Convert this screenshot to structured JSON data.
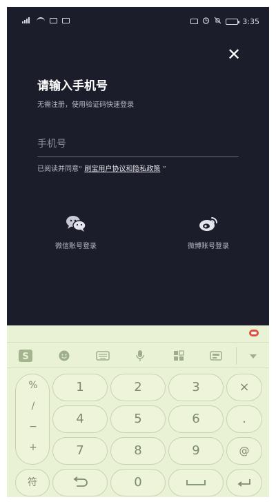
{
  "status_bar": {
    "left_icons": [
      "signal-icon",
      "wifi-icon",
      "sim-icon",
      "sim-icon"
    ],
    "right_icons": [
      "nfc-icon",
      "alarm-icon",
      "mute-icon",
      "battery-icon"
    ],
    "time": "3:35"
  },
  "login": {
    "close_symbol": "✕",
    "title": "请输入手机号",
    "subtitle": "无需注册，使用验证码快速登录",
    "phone_placeholder": "手机号",
    "agreement_prefix": "已阅读并同意",
    "agreement_open": "“",
    "agreement_link": "刷宝用户协议和隐私政策",
    "agreement_close": "”"
  },
  "social": {
    "wechat_label": "微信账号登录",
    "weibo_label": "微博账号登录"
  },
  "keyboard": {
    "toolbar_icons": [
      "sogou-logo-icon",
      "emoji-icon",
      "keyboard-icon",
      "microphone-icon",
      "apps-grid-icon",
      "clipboard-icon",
      "collapse-icon"
    ],
    "side_symbols": [
      "%",
      "/",
      "−",
      "+"
    ],
    "rows": [
      [
        "1",
        "2",
        "3"
      ],
      [
        "4",
        "5",
        "6"
      ],
      [
        "7",
        "8",
        "9"
      ]
    ],
    "right_keys": [
      "×",
      ".",
      "@"
    ],
    "bottom": {
      "symbols_label": "符",
      "back_icon": "return-arrow-icon",
      "zero": "0",
      "space_icon": "space-bar-icon",
      "enter_icon": "enter-icon"
    },
    "accent_red": "#e0503c"
  }
}
